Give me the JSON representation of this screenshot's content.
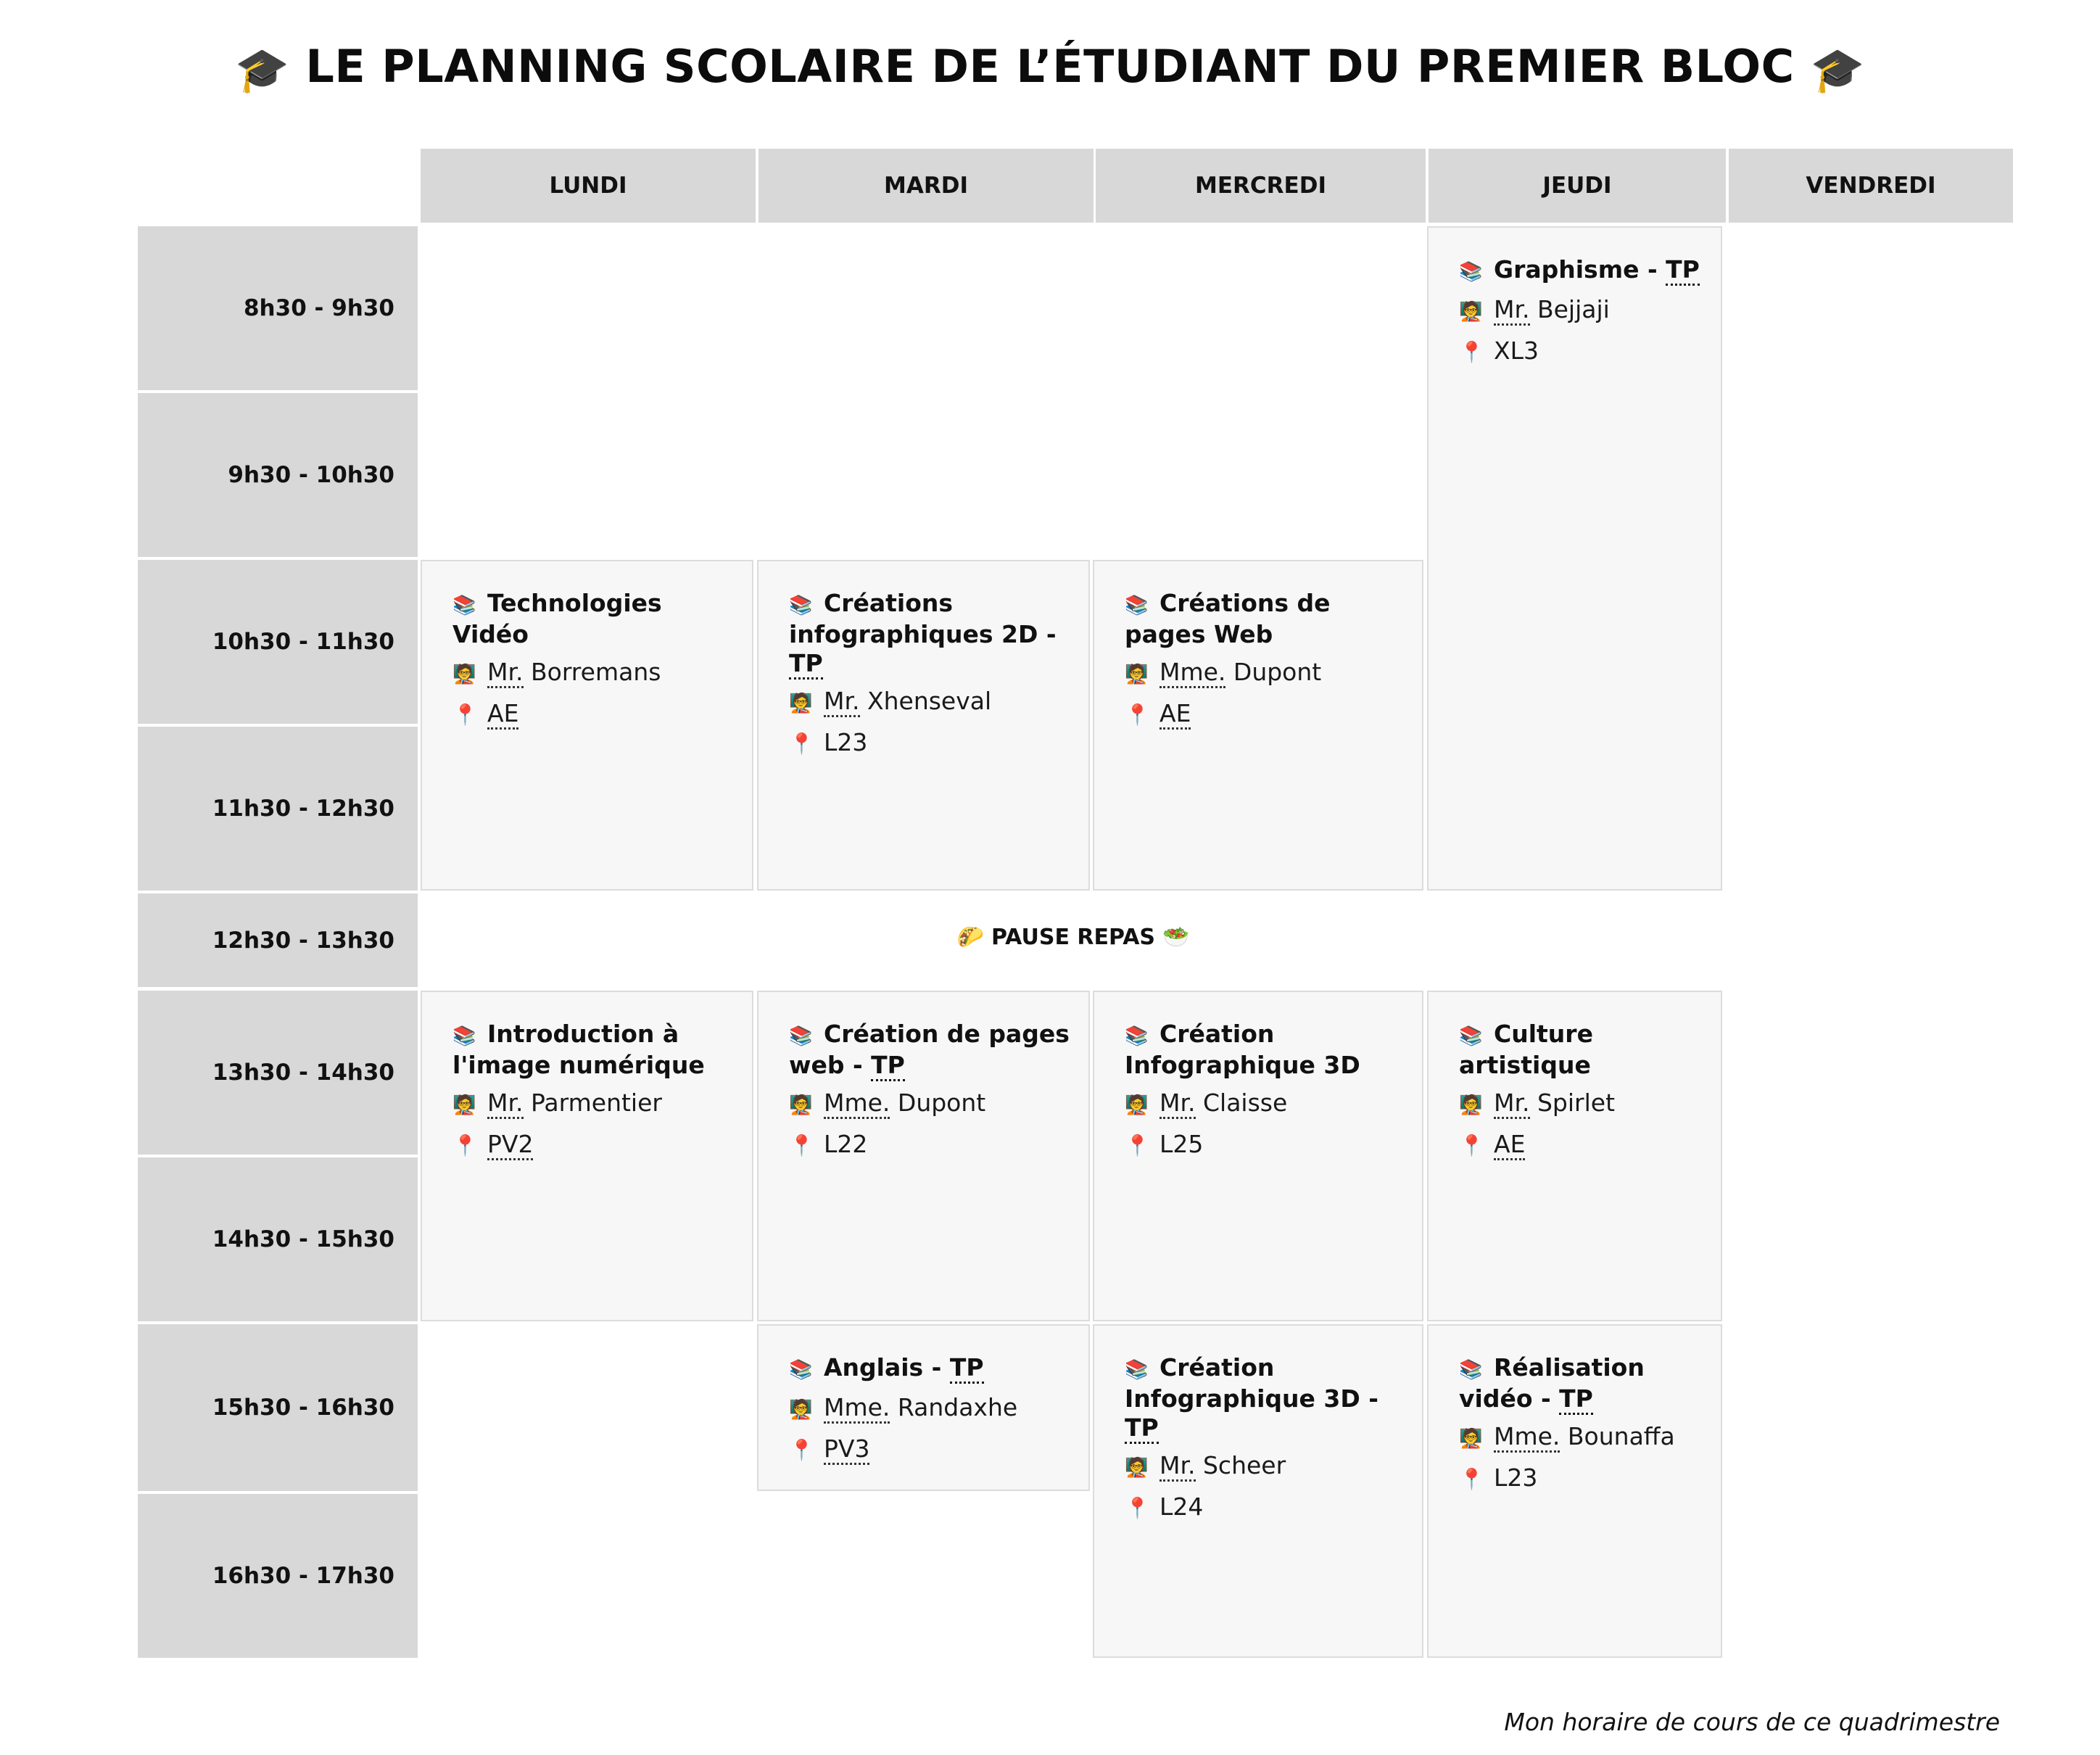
{
  "title": {
    "icon": "graduation-cap-icon",
    "text": "LE PLANNING SCOLAIRE DE L’ÉTUDIANT DU PREMIER BLOC"
  },
  "days": [
    "LUNDI",
    "MARDI",
    "MERCREDI",
    "JEUDI",
    "VENDREDI"
  ],
  "times": [
    "8h30 - 9h30",
    "9h30 - 10h30",
    "10h30 - 11h30",
    "11h30 - 12h30",
    "12h30 - 13h30",
    "13h30 - 14h30",
    "14h30 - 15h30",
    "15h30 - 16h30",
    "16h30 - 17h30"
  ],
  "icons": {
    "course": "books-icon",
    "teacher": "teacher-icon",
    "room": "pin-icon"
  },
  "courses": [
    {
      "day": "JEUDI",
      "time": "8h30 - 9h30",
      "course": "Graphisme - ",
      "tag": "TP",
      "title_abbr": "Mr.",
      "teacher": " Bejjaji",
      "room": "XL3",
      "room_abbr": ""
    },
    {
      "day": "LUNDI",
      "time": "10h30 - 11h30",
      "course": "Technologies Vidéo",
      "tag": "",
      "title_abbr": "Mr.",
      "teacher": " Borremans",
      "room": "",
      "room_abbr": "AE"
    },
    {
      "day": "MARDI",
      "time": "10h30 - 11h30",
      "course": "Créations infographiques 2D - ",
      "tag": "TP",
      "title_abbr": "Mr.",
      "teacher": " Xhenseval",
      "room": "L23",
      "room_abbr": ""
    },
    {
      "day": "MERCREDI",
      "time": "10h30 - 11h30",
      "course": "Créations de pages Web",
      "tag": "",
      "title_abbr": "Mme.",
      "teacher": " Dupont",
      "room": "",
      "room_abbr": "AE"
    },
    {
      "day": "LUNDI",
      "time": "13h30 - 14h30",
      "course": "Introduction à l'image numérique",
      "tag": "",
      "title_abbr": "Mr.",
      "teacher": " Parmentier",
      "room": "",
      "room_abbr": "PV2"
    },
    {
      "day": "MARDI",
      "time": "13h30 - 14h30",
      "course": "Création de pages web - ",
      "tag": "TP",
      "title_abbr": "Mme.",
      "teacher": " Dupont",
      "room": "L22",
      "room_abbr": ""
    },
    {
      "day": "MERCREDI",
      "time": "13h30 - 14h30",
      "course": "Création Infographique 3D",
      "tag": "",
      "title_abbr": "Mr.",
      "teacher": " Claisse",
      "room": "L25",
      "room_abbr": ""
    },
    {
      "day": "JEUDI",
      "time": "13h30 - 14h30",
      "course": "Culture artistique",
      "tag": "",
      "title_abbr": "Mr.",
      "teacher": " Spirlet",
      "room": "",
      "room_abbr": "AE"
    },
    {
      "day": "MARDI",
      "time": "15h30 - 16h30",
      "course": "Anglais - ",
      "tag": "TP",
      "title_abbr": "Mme.",
      "teacher": " Randaxhe",
      "room": "",
      "room_abbr": "PV3"
    },
    {
      "day": "MERCREDI",
      "time": "15h30 - 16h30",
      "course": "Création Infographique 3D - ",
      "tag": "TP",
      "title_abbr": "Mr.",
      "teacher": " Scheer",
      "room": "L24",
      "room_abbr": ""
    },
    {
      "day": "JEUDI",
      "time": "15h30 - 16h30",
      "course": "Réalisation vidéo - ",
      "tag": "TP",
      "title_abbr": "Mme.",
      "teacher": " Bounaffa",
      "room": "L23",
      "room_abbr": ""
    }
  ],
  "pause": {
    "text": "PAUSE REPAS",
    "icon_left": "taco-icon",
    "icon_right": "salad-icon"
  },
  "footer": "Mon horaire de cours de ce quadrimestre"
}
